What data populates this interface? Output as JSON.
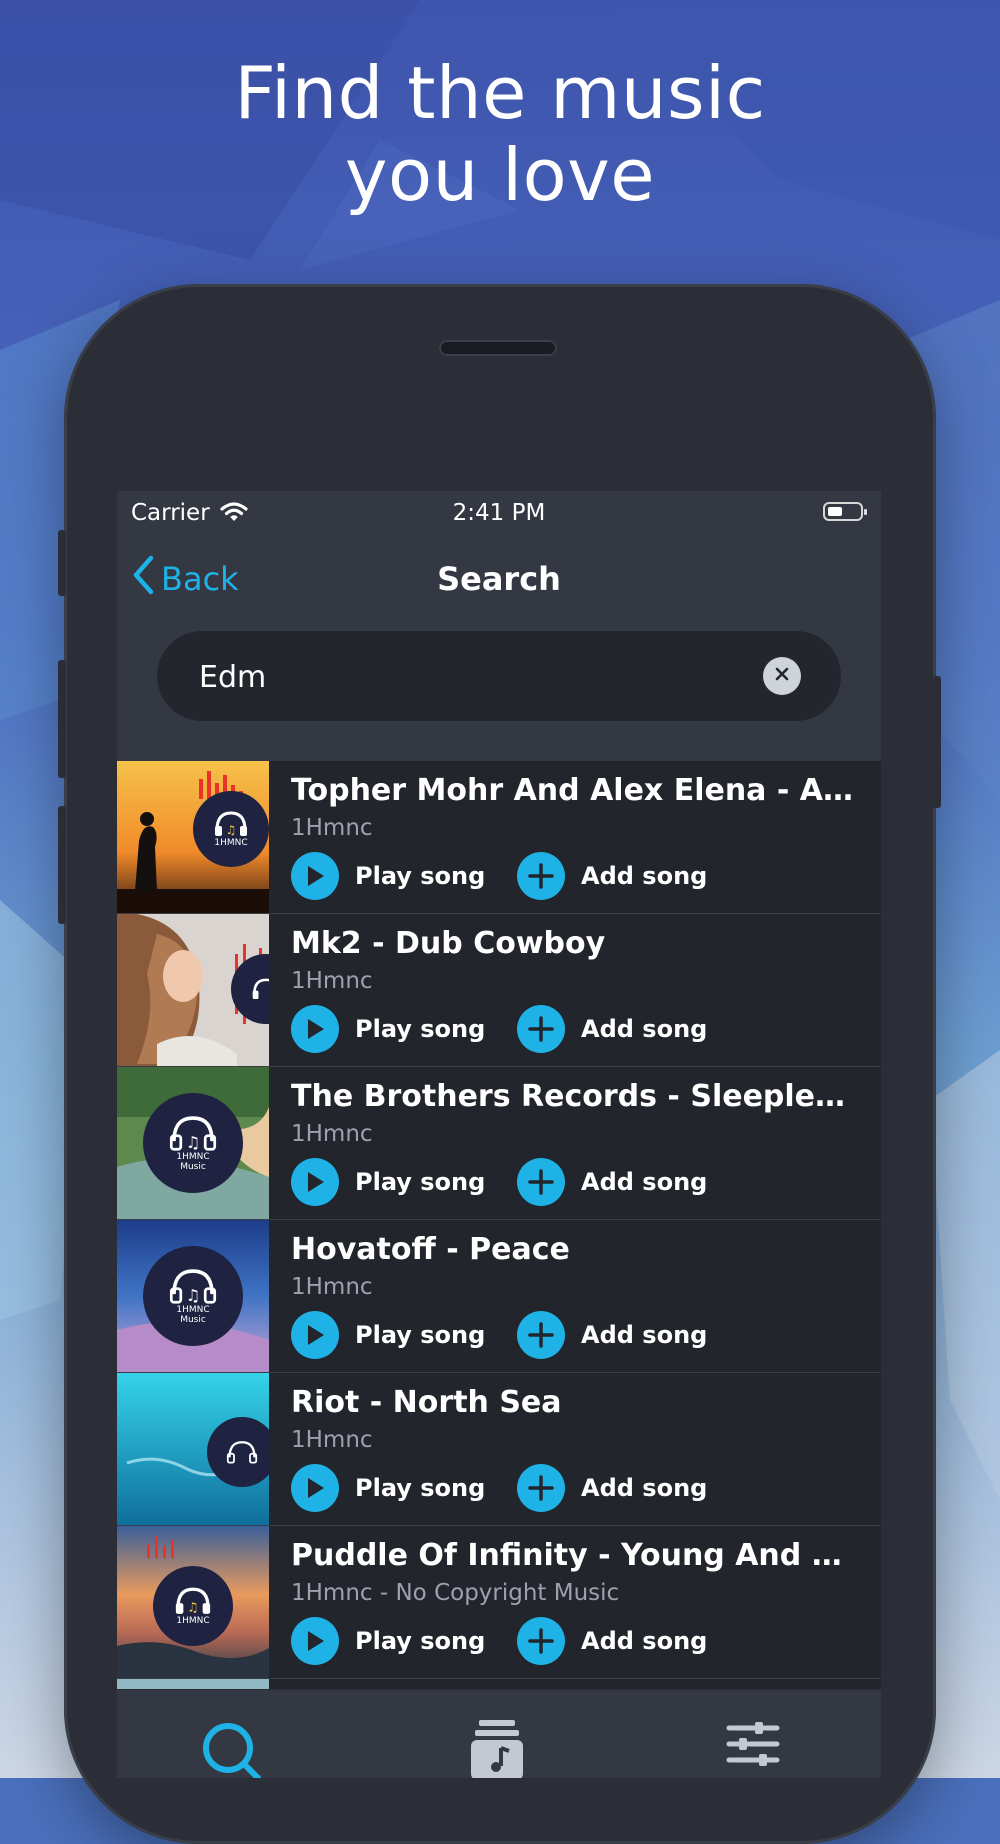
{
  "promo": {
    "headline_line1": "Find the music",
    "headline_line2": "you love"
  },
  "colors": {
    "accent": "#1fb2e6",
    "screen_bg": "#343843",
    "row_bg": "#22252c",
    "background_top": "#4159b3",
    "background_bottom": "#c8d3e4"
  },
  "status_bar": {
    "carrier": "Carrier",
    "time": "2:41 PM"
  },
  "nav": {
    "back_label": "Back",
    "title": "Search"
  },
  "search": {
    "value": "Edm",
    "placeholder": ""
  },
  "results": [
    {
      "title": "Topher Mohr And Alex Elena - A W...",
      "artist": "1Hmnc",
      "play_label": "Play song",
      "add_label": "Add song"
    },
    {
      "title": "Mk2 - Dub Cowboy",
      "artist": "1Hmnc",
      "play_label": "Play song",
      "add_label": "Add song"
    },
    {
      "title": "The Brothers Records - Sleeplessn...",
      "artist": "1Hmnc",
      "play_label": "Play song",
      "add_label": "Add song"
    },
    {
      "title": "Hovatoff - Peace",
      "artist": "1Hmnc",
      "play_label": "Play song",
      "add_label": "Add song"
    },
    {
      "title": "Riot - North Sea",
      "artist": "1Hmnc",
      "play_label": "Play song",
      "add_label": "Add song"
    },
    {
      "title": "Puddle Of Infinity - Young And Old...",
      "artist": "1Hmnc - No Copyright Music",
      "play_label": "Play song",
      "add_label": "Add song"
    }
  ],
  "thumb_logo": {
    "line1": "1HMNC",
    "line2": "Music"
  },
  "tabs": [
    {
      "icon": "search-icon",
      "active": true
    },
    {
      "icon": "music-library-icon",
      "active": false
    },
    {
      "icon": "sliders-icon",
      "active": false
    }
  ]
}
